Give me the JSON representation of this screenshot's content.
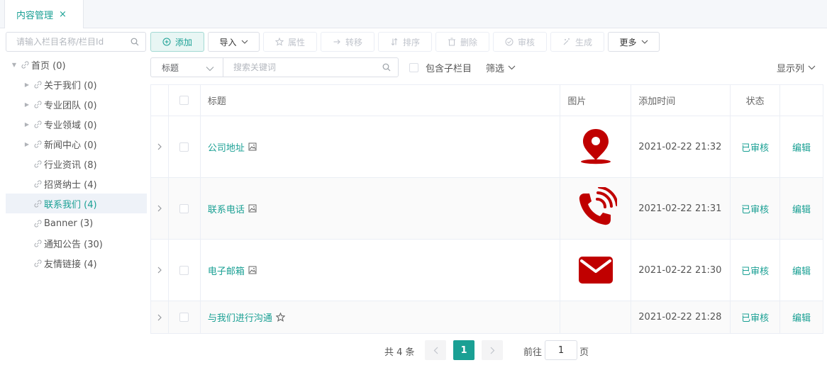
{
  "tab": {
    "label": "内容管理",
    "close": "×"
  },
  "sidebar": {
    "search_placeholder": "请输入栏目名称/栏目Id",
    "tree": [
      {
        "label": "首页 (0)",
        "level": 0,
        "expanded": true,
        "active": false
      },
      {
        "label": "关于我们 (0)",
        "level": 1,
        "has_children": true,
        "active": false
      },
      {
        "label": "专业团队 (0)",
        "level": 1,
        "has_children": true,
        "active": false
      },
      {
        "label": "专业领域 (0)",
        "level": 1,
        "has_children": true,
        "active": false
      },
      {
        "label": "新闻中心 (0)",
        "level": 1,
        "has_children": true,
        "active": false
      },
      {
        "label": "行业资讯 (8)",
        "level": 1,
        "has_children": false,
        "active": false
      },
      {
        "label": "招贤纳士 (4)",
        "level": 1,
        "has_children": false,
        "active": false
      },
      {
        "label": "联系我们 (4)",
        "level": 1,
        "has_children": false,
        "active": true
      },
      {
        "label": "Banner (3)",
        "level": 1,
        "has_children": false,
        "active": false
      },
      {
        "label": "通知公告 (30)",
        "level": 1,
        "has_children": false,
        "active": false
      },
      {
        "label": "友情链接 (4)",
        "level": 1,
        "has_children": false,
        "active": false
      }
    ]
  },
  "toolbar": {
    "add": "添加",
    "import": "导入",
    "attr": "属性",
    "move": "转移",
    "sort": "排序",
    "delete": "删除",
    "audit": "审核",
    "generate": "生成",
    "more": "更多"
  },
  "filter": {
    "field_select": "标题",
    "keyword_placeholder": "搜索关键词",
    "include_sub": "包含子栏目",
    "screen": "筛选",
    "columns": "显示列"
  },
  "table": {
    "headers": {
      "title": "标题",
      "image": "图片",
      "time": "添加时间",
      "status": "状态"
    },
    "rows": [
      {
        "title": "公司地址",
        "title_icon": "image-icon",
        "image": "location-pin-icon",
        "time": "2021-02-22 21:32",
        "status": "已审核",
        "action": "编辑"
      },
      {
        "title": "联系电话",
        "title_icon": "image-icon",
        "image": "phone-call-icon",
        "time": "2021-02-22 21:31",
        "status": "已审核",
        "action": "编辑"
      },
      {
        "title": "电子邮箱",
        "title_icon": "image-icon",
        "image": "email-envelope-icon",
        "time": "2021-02-22 21:30",
        "status": "已审核",
        "action": "编辑"
      },
      {
        "title": "与我们进行沟通",
        "title_icon": "star-icon",
        "image": "",
        "time": "2021-02-22 21:28",
        "status": "已审核",
        "action": "编辑"
      }
    ]
  },
  "pagination": {
    "total": "共 4 条",
    "current_page": "1",
    "goto_label": "前往",
    "goto_value": "1",
    "page_suffix": "页"
  },
  "colors": {
    "accent": "#1aa094",
    "icon_red": "#c00000"
  }
}
